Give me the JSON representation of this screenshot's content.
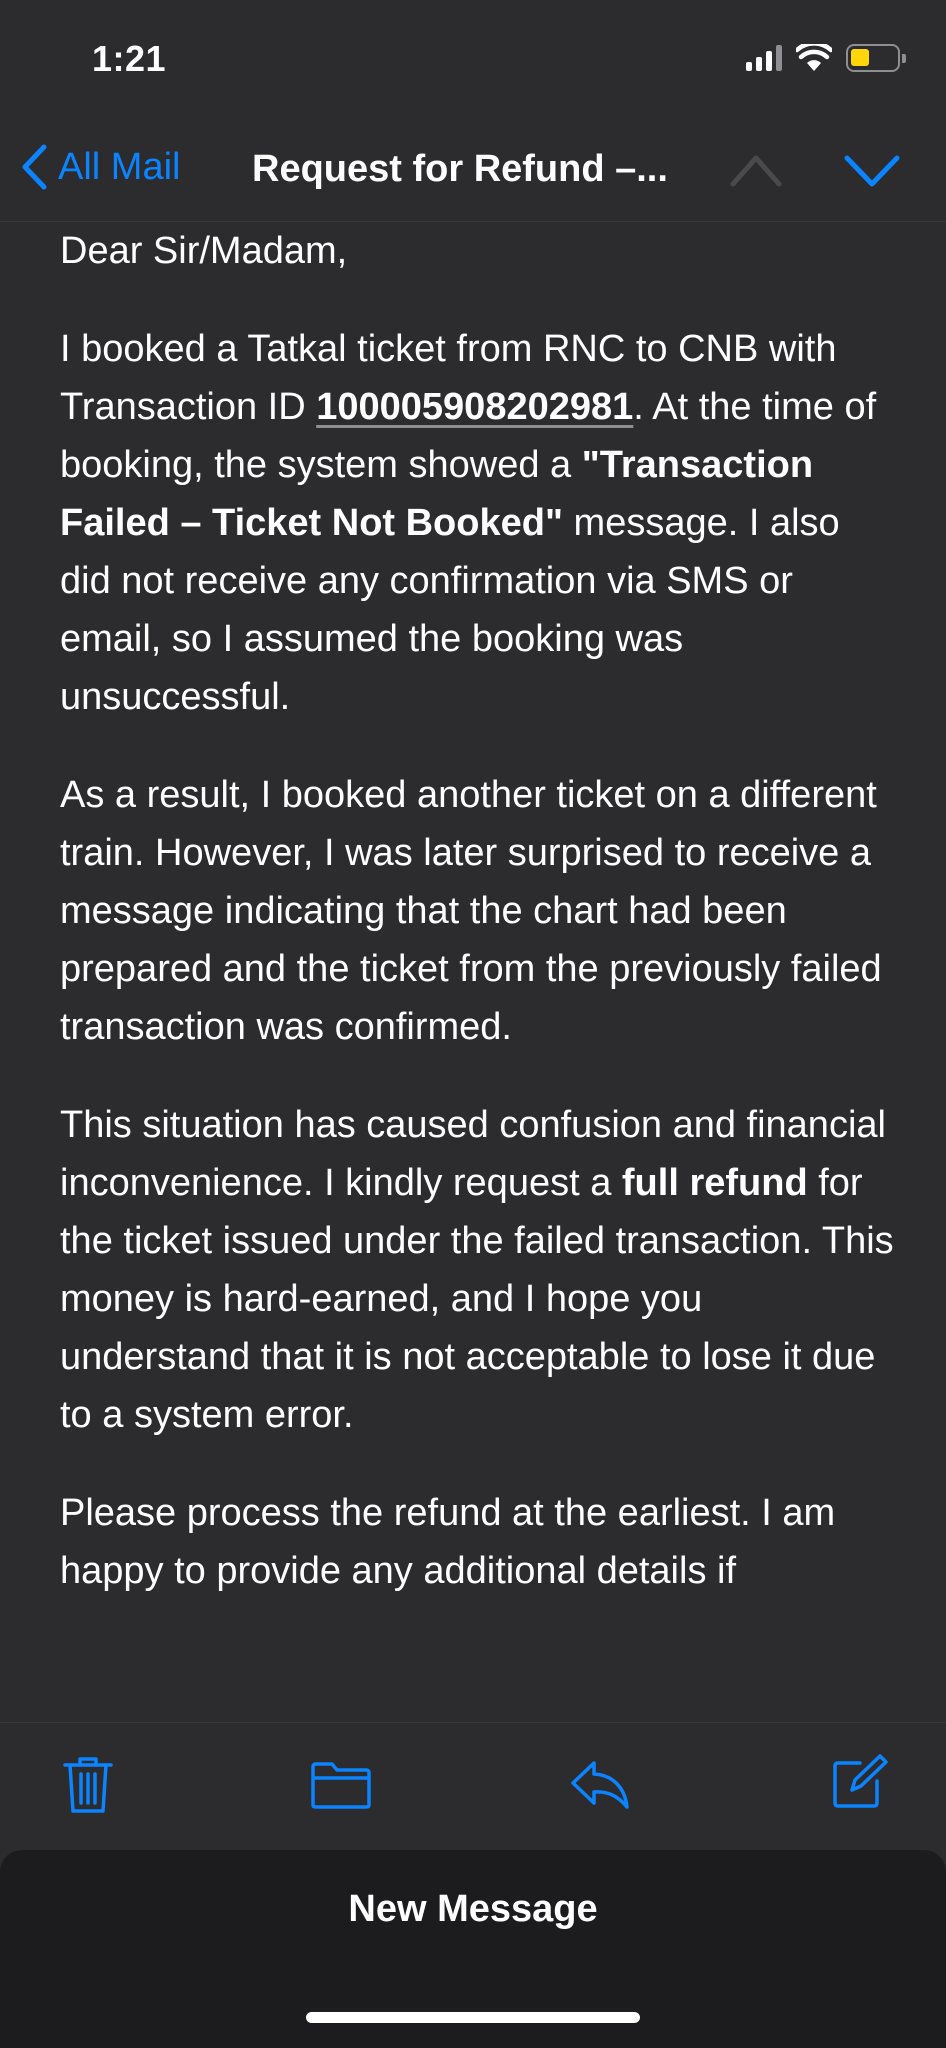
{
  "status_bar": {
    "time": "1:21",
    "battery_color": "#ffd60a"
  },
  "nav": {
    "back_label": "All Mail",
    "title": "Request for Refund –...",
    "accent_color": "#0a84ff"
  },
  "email": {
    "greeting": "Dear Sir/Madam,",
    "p1": {
      "t1": "I booked a Tatkal ticket from RNC to CNB with Transaction ID ",
      "transaction_id": "100005908202981",
      "t2": ". At the time of booking, the system showed a ",
      "bold": "\"Transaction Failed – Ticket Not Booked\"",
      "t3": " message. I also did not receive any confirmation via SMS or email, so I assumed the booking was unsuccessful."
    },
    "p2": "As a result, I booked another ticket on a different train. However, I was later surprised to receive a message indicating that the chart had been prepared and the ticket from the previously failed transaction was confirmed.",
    "p3": {
      "t1": "This situation has caused confusion and financial inconvenience. I kindly request a ",
      "bold": "full refund",
      "t2": " for the ticket issued under the failed transaction. This money is hard-earned, and I hope you understand that it is not acceptable to lose it due to a system error."
    },
    "p4": "Please process the refund at the earliest. I am happy to provide any additional details if"
  },
  "toolbar": {
    "icons": [
      "trash-icon",
      "folder-icon",
      "reply-icon",
      "compose-icon"
    ]
  },
  "compose_sheet": {
    "title": "New Message"
  }
}
